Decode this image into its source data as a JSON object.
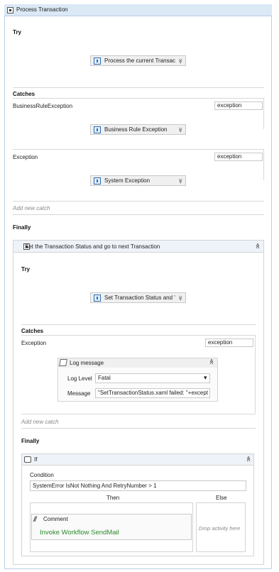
{
  "root": {
    "title": "Process Transaction",
    "try_label": "Try",
    "try_activity": "Process the current Transac",
    "catches_label": "Catches",
    "catches": [
      {
        "type": "BusinessRuleException",
        "var": "exception",
        "activity": "Business Rule Exception"
      },
      {
        "type": "Exception",
        "var": "exception",
        "activity": "System Exception"
      }
    ],
    "add_catch": "Add new catch",
    "finally_label": "Finally"
  },
  "inner": {
    "title": "Set the Transaction Status and go to next Transaction",
    "try_label": "Try",
    "try_activity": "Set Transaction Status and '",
    "catches_label": "Catches",
    "catch_type": "Exception",
    "catch_var": "exception",
    "log": {
      "title": "Log message",
      "level_label": "Log Level",
      "level_value": "Fatal",
      "message_label": "Message",
      "message_value": "\"SetTransactionStatus.xaml failed: \"+except"
    },
    "add_catch": "Add new catch",
    "finally_label": "Finally"
  },
  "if_block": {
    "title": "If",
    "condition_label": "Condition",
    "condition_value": "SystemError IsNot Nothing And RetryNumber > 1",
    "then_label": "Then",
    "else_label": "Else",
    "comment_title": "Comment",
    "comment_text": "Invoke Workflow SendMail",
    "drop_hint": "Drop activity here"
  },
  "glyphs": {
    "chevron_down": "≫",
    "collapse_up": "≪",
    "dropdown_arrow": "▾"
  }
}
